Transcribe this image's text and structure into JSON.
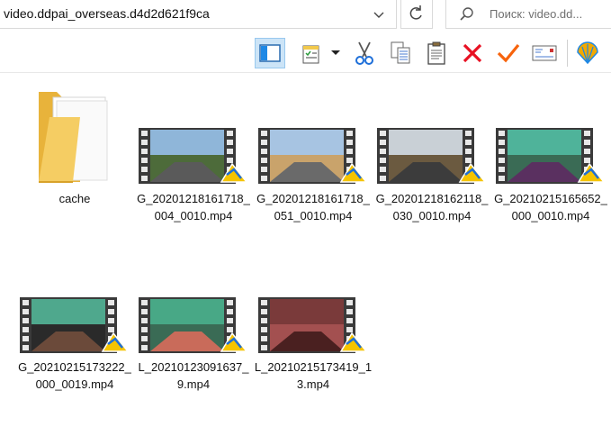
{
  "address": {
    "path": "video.ddpai_overseas.d4d2d621f9ca"
  },
  "search": {
    "placeholder": "Поиск: video.dd..."
  },
  "toolbar": {
    "icons": [
      "preview-pane-icon",
      "properties-icon",
      "cut-icon",
      "copy-icon",
      "paste-icon",
      "delete-icon",
      "check-icon",
      "email-icon",
      "shell-icon"
    ]
  },
  "files": [
    {
      "name": "cache",
      "kind": "folder"
    },
    {
      "name": "G_20201218161718_004_0010.mp4",
      "kind": "video"
    },
    {
      "name": "G_20201218161718_051_0010.mp4",
      "kind": "video"
    },
    {
      "name": "G_20201218162118_030_0010.mp4",
      "kind": "video"
    },
    {
      "name": "G_20210215165652_000_0010.mp4",
      "kind": "video"
    },
    {
      "name": "G_20210215173222_000_0019.mp4",
      "kind": "video"
    },
    {
      "name": "L_20210123091637_9.mp4",
      "kind": "video"
    },
    {
      "name": "L_20210215173419_13.mp4",
      "kind": "video"
    }
  ],
  "colors": {
    "accent": "#cce4f7",
    "delete": "#e81123",
    "check": "#f7630c"
  }
}
